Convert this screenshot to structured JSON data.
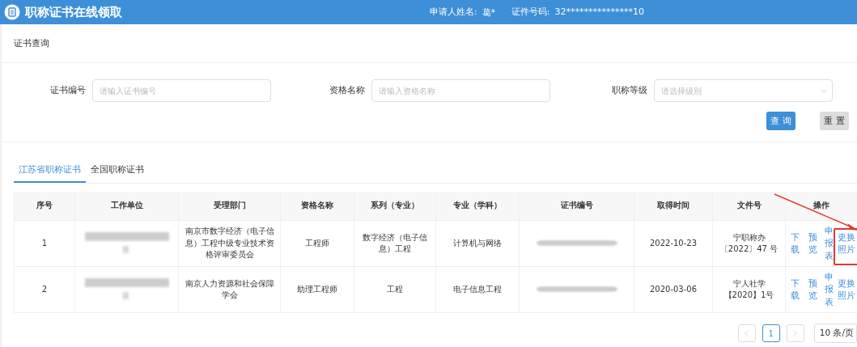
{
  "header": {
    "title": "职称证书在线领取",
    "applicant_label": "申请人姓名:",
    "applicant_name": "葛*",
    "id_label": "证件号码:",
    "id_number": "32***************10"
  },
  "section_title": "证书查询",
  "filters": [
    {
      "label": "证书编号",
      "placeholder": "请输入证书编号",
      "kind": "input"
    },
    {
      "label": "资格名称",
      "placeholder": "请输入资格名称",
      "kind": "input"
    },
    {
      "label": "职称等级",
      "placeholder": "请选择级别",
      "kind": "select"
    }
  ],
  "buttons": [
    {
      "label": "查 询",
      "kind": "primary"
    },
    {
      "label": "重 置",
      "kind": "default"
    }
  ],
  "tabs": [
    {
      "label": "江苏省职称证书",
      "selected": true
    },
    {
      "label": "全国职称证书",
      "selected": false
    }
  ],
  "table": {
    "columns": [
      "序号",
      "工作单位",
      "受理部门",
      "资格名称",
      "系列（专业）",
      "专业（学科）",
      "证书编号",
      "取得时间",
      "文件号",
      "操作"
    ],
    "rows": [
      {
        "cells": [
          {
            "kind": "text",
            "text": "1"
          },
          {
            "kind": "redacted"
          },
          {
            "kind": "text",
            "text": "南京市数字经济（电子信息）工程中级专业技术资格评审委员会"
          },
          {
            "kind": "text",
            "text": "工程师"
          },
          {
            "kind": "text",
            "text": "数字经济（电子信息）工程"
          },
          {
            "kind": "text",
            "text": "计算机与网络"
          },
          {
            "kind": "redacted"
          },
          {
            "kind": "text",
            "text": "2022-10-23"
          },
          {
            "kind": "text",
            "text": "宁职称办〔2022〕47 号"
          },
          {
            "kind": "actions",
            "actions": [
              "下载",
              "预览",
              "申报表",
              "更换照片"
            ]
          }
        ]
      },
      {
        "cells": [
          {
            "kind": "text",
            "text": "2"
          },
          {
            "kind": "redacted"
          },
          {
            "kind": "text",
            "text": "南京人力资源和社会保障学会"
          },
          {
            "kind": "text",
            "text": "助理工程师"
          },
          {
            "kind": "text",
            "text": "工程"
          },
          {
            "kind": "text",
            "text": "电子信息工程"
          },
          {
            "kind": "redacted"
          },
          {
            "kind": "text",
            "text": "2020-03-06"
          },
          {
            "kind": "text",
            "text": "宁人社学【2020】1号"
          },
          {
            "kind": "actions",
            "actions": [
              "下载",
              "预览",
              "申报表",
              "更换照片"
            ]
          }
        ]
      }
    ]
  },
  "pagination": {
    "pages": [
      {
        "label": "1",
        "selected": true
      }
    ],
    "page_size": "10 条/页"
  }
}
